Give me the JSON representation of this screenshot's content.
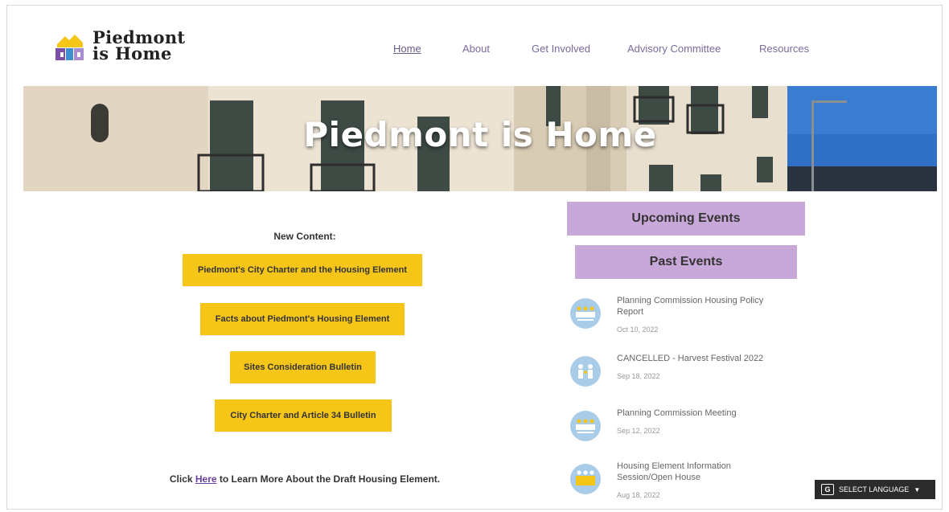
{
  "header": {
    "logo_line1": "Piedmont",
    "logo_line2": "is Home"
  },
  "nav": {
    "items": [
      {
        "label": "Home"
      },
      {
        "label": "About"
      },
      {
        "label": "Get Involved"
      },
      {
        "label": "Advisory Committee"
      },
      {
        "label": "Resources"
      }
    ]
  },
  "hero": {
    "title": "Piedmont is Home"
  },
  "left": {
    "heading": "New Content:",
    "buttons": [
      "Piedmont's City Charter and the Housing Element",
      "Facts about Piedmont's Housing Element",
      "Sites Consideration Bulletin",
      "City Charter and Article 34 Bulletin"
    ],
    "bottom_prefix": "Click ",
    "bottom_link": "Here",
    "bottom_suffix": " to Learn More About the Draft Housing Element."
  },
  "right": {
    "upcoming_label": "Upcoming Events",
    "past_label": "Past Events",
    "events": [
      {
        "title": "Planning Commission Housing Policy Report",
        "date": "Oct 10, 2022"
      },
      {
        "title": "CANCELLED - Harvest Festival 2022",
        "date": "Sep 18, 2022"
      },
      {
        "title": "Planning Commission Meeting",
        "date": "Sep 12, 2022"
      },
      {
        "title": "Housing Element Information Session/Open House",
        "date": "Aug 18, 2022"
      }
    ]
  },
  "language": {
    "label": "SELECT LANGUAGE",
    "icon": "google-translate-icon"
  },
  "colors": {
    "yellow": "#f5c518",
    "purple": "#c8a8d8",
    "nav": "#7a6a9a"
  }
}
